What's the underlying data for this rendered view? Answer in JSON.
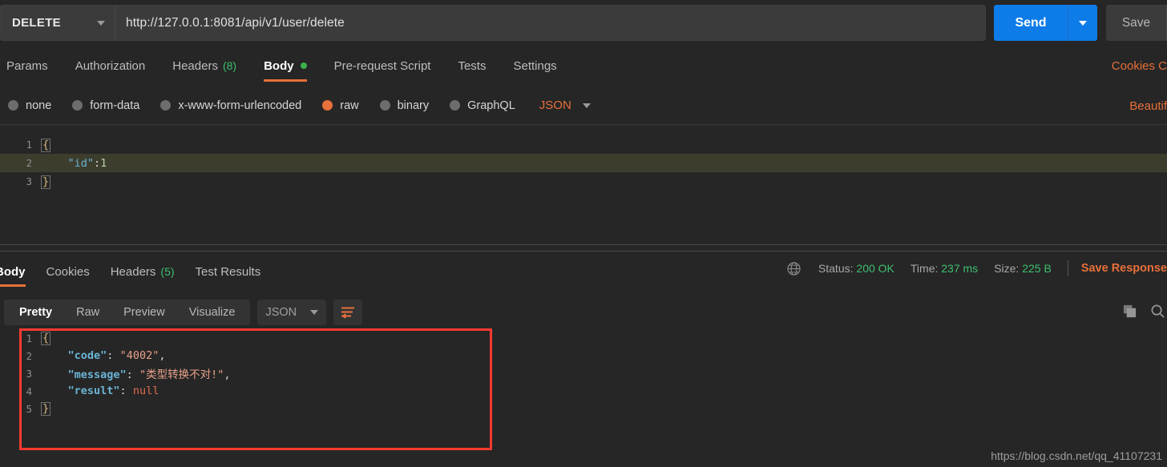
{
  "request": {
    "method": "DELETE",
    "url": "http://127.0.0.1:8081/api/v1/user/delete",
    "send_label": "Send",
    "save_label": "Save",
    "tabs": [
      {
        "label": "Params",
        "count": "",
        "active": false,
        "dot": false
      },
      {
        "label": "Authorization",
        "count": "",
        "active": false,
        "dot": false
      },
      {
        "label": "Headers",
        "count": "(8)",
        "active": false,
        "dot": false
      },
      {
        "label": "Body",
        "count": "",
        "active": true,
        "dot": true
      },
      {
        "label": "Pre-request Script",
        "count": "",
        "active": false,
        "dot": false
      },
      {
        "label": "Tests",
        "count": "",
        "active": false,
        "dot": false
      },
      {
        "label": "Settings",
        "count": "",
        "active": false,
        "dot": false
      }
    ],
    "cookies_link": "Cookies  C",
    "beautify_link": "Beautif",
    "body_types": [
      {
        "label": "none",
        "selected": false
      },
      {
        "label": "form-data",
        "selected": false
      },
      {
        "label": "x-www-form-urlencoded",
        "selected": false
      },
      {
        "label": "raw",
        "selected": true
      },
      {
        "label": "binary",
        "selected": false
      },
      {
        "label": "GraphQL",
        "selected": false
      }
    ],
    "raw_format": "JSON",
    "body_lines": [
      {
        "num": "1",
        "highlight": false
      },
      {
        "num": "2",
        "highlight": true
      },
      {
        "num": "3",
        "highlight": false
      }
    ],
    "body_code": {
      "open_brace": "{",
      "key": "\"id\"",
      "colon": ":",
      "value": "1",
      "close_brace": "}"
    }
  },
  "response": {
    "tabs": [
      {
        "label": "Body",
        "count": "",
        "active": true
      },
      {
        "label": "Cookies",
        "count": "",
        "active": false
      },
      {
        "label": "Headers",
        "count": "(5)",
        "active": false
      },
      {
        "label": "Test Results",
        "count": "",
        "active": false
      }
    ],
    "status_label": "Status:",
    "status_value": "200 OK",
    "time_label": "Time:",
    "time_value": "237 ms",
    "size_label": "Size:",
    "size_value": "225 B",
    "save_response": "Save Response",
    "view_modes": [
      {
        "label": "Pretty",
        "active": true
      },
      {
        "label": "Raw",
        "active": false
      },
      {
        "label": "Preview",
        "active": false
      },
      {
        "label": "Visualize",
        "active": false
      }
    ],
    "format": "JSON",
    "lines": [
      {
        "num": "1"
      },
      {
        "num": "2"
      },
      {
        "num": "3"
      },
      {
        "num": "4"
      },
      {
        "num": "5"
      }
    ],
    "json": {
      "open_brace": "{",
      "key_code": "\"code\"",
      "val_code": "\"4002\"",
      "key_message": "\"message\"",
      "val_message": "\"类型转换不对!\"",
      "key_result": "\"result\"",
      "val_result": "null",
      "comma": ",",
      "colon": ": ",
      "close_brace": "}"
    }
  },
  "watermark": "https://blog.csdn.net/qq_41107231",
  "colors": {
    "accent_orange": "#e8703a",
    "send_blue": "#0d7ce8",
    "status_green": "#3dbf6e",
    "annotation_red": "#f93a2f",
    "background": "#262626"
  }
}
